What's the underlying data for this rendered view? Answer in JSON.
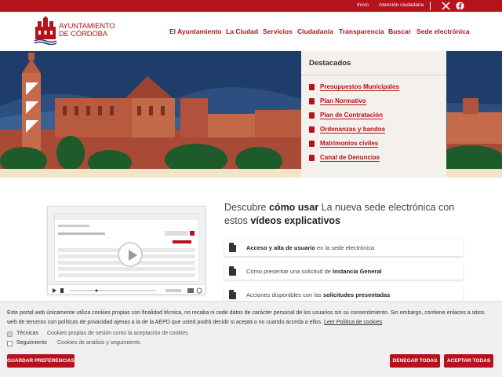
{
  "topbar": {
    "inicio": "Inicio",
    "atencion": "Atención ciudadana",
    "social": [
      "x-icon",
      "facebook-icon"
    ]
  },
  "logo": {
    "line1": "AYUNTAMIENTO",
    "line2": "DE CÓRDOBA"
  },
  "nav": [
    {
      "label": "El Ayuntamiento"
    },
    {
      "label": "La Ciudad"
    },
    {
      "label": "Servicios"
    },
    {
      "label": "Ciudadanía"
    },
    {
      "label": "Transparencia"
    },
    {
      "label": "Buscar"
    },
    {
      "label": "Sede electrónica"
    }
  ],
  "destacados": {
    "title": "Destacados",
    "items": [
      {
        "label": "Presupuestos Municipales",
        "icon": "document-icon"
      },
      {
        "label": "Plan Normativo",
        "icon": "flag-icon"
      },
      {
        "label": "Plan de Contratación",
        "icon": "handshake-icon"
      },
      {
        "label": "Ordenanzas y bandos",
        "icon": "book-icon"
      },
      {
        "label": "Matrimonios civiles",
        "icon": "rings-icon"
      },
      {
        "label": "Canal de Denuncias",
        "icon": "megaphone-icon"
      }
    ]
  },
  "content": {
    "title_pre": "Descubre ",
    "title_bold1": "cómo usar",
    "title_mid": " La nueva sede electrónica con estos ",
    "title_bold2": "vídeos explicativos",
    "actions": [
      {
        "bold": "Acceso y alta de usuario",
        "rest": " en la sede electrónica",
        "bold_first": true
      },
      {
        "pre": "Cómo presentar una solicitud de ",
        "bold": "Instancia General",
        "bold_first": false
      },
      {
        "pre": "Acciones disponibles con las ",
        "bold": "solicitudes presentadas",
        "bold_first": false
      }
    ]
  },
  "cookie": {
    "text": "Este portal web únicamente utiliza cookies propias con finalidad técnica, no recaba ni cede datos de carácter personal de los usuarios sin su consentimiento. Sin embargo, contiene enlaces a sitios web de terceros con políticas de privacidad ajenas a la de la AEPD que usted podrá decidir si acepta o no cuando acceda a ellos.",
    "link": "Leer Política de cookies",
    "options": [
      {
        "label": "Técnicas",
        "desc": "Cookies propias de sesión como la aceptación de cookies",
        "checked": true
      },
      {
        "label": "Seguimiento",
        "desc": "Cookies de análisis y seguimiento.",
        "checked": false
      }
    ],
    "buttons": {
      "save": "GUARDAR PREFERENCIAS",
      "deny": "DENEGAR TODAS",
      "accept": "ACEPTAR TODAS"
    }
  },
  "colors": {
    "brand": "#b5121b",
    "hero_sky": "#1f3d6b",
    "panel": "#f4f1ec"
  }
}
